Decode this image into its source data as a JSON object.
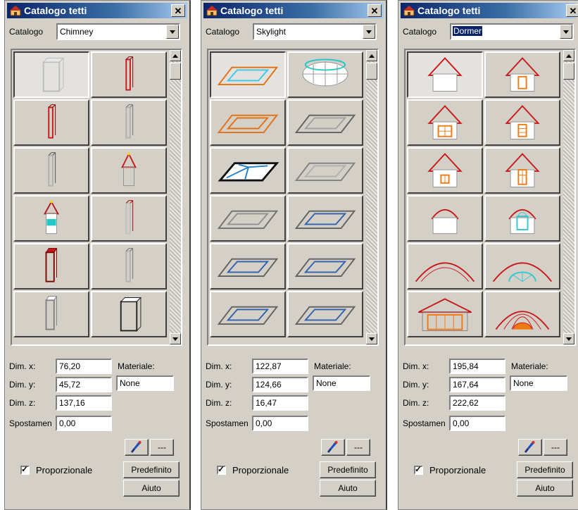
{
  "panels": [
    {
      "title": "Catalogo tetti",
      "catalog_label": "Catalogo",
      "catalog_value": "Chimney",
      "catalog_focused": false,
      "thumbnail_kind": "chimney",
      "fields": [
        {
          "label": "Dim. x:",
          "value": "76,20"
        },
        {
          "label": "Dim. y:",
          "value": "45,72"
        },
        {
          "label": "Dim. z:",
          "value": "137,16"
        },
        {
          "label": "Spostamen",
          "value": "0,00"
        }
      ],
      "material_label": "Materiale:",
      "material_value": "None",
      "dash_button": "---",
      "proportional_label": "Proporzionale",
      "proportional_checked": true,
      "default_button": "Predefinito",
      "help_button": "Aiuto"
    },
    {
      "title": "Catalogo tetti",
      "catalog_label": "Catalogo",
      "catalog_value": "Skylight",
      "catalog_focused": false,
      "thumbnail_kind": "skylight",
      "fields": [
        {
          "label": "Dim. x:",
          "value": "122,87"
        },
        {
          "label": "Dim. y:",
          "value": "124,66"
        },
        {
          "label": "Dim. z:",
          "value": "16,47"
        },
        {
          "label": "Spostamen",
          "value": "0,00"
        }
      ],
      "material_label": "Materiale:",
      "material_value": "None",
      "dash_button": "---",
      "proportional_label": "Proporzionale",
      "proportional_checked": true,
      "default_button": "Predefinito",
      "help_button": "Aiuto"
    },
    {
      "title": "Catalogo tetti",
      "catalog_label": "Catalogo",
      "catalog_value": "Dormer",
      "catalog_focused": true,
      "thumbnail_kind": "dormer",
      "fields": [
        {
          "label": "Dim. x:",
          "value": "195,84"
        },
        {
          "label": "Dim. y:",
          "value": "167,64"
        },
        {
          "label": "Dim. z:",
          "value": "222,62"
        },
        {
          "label": "Spostamen",
          "value": "0,00"
        }
      ],
      "material_label": "Materiale:",
      "material_value": "None",
      "dash_button": "---",
      "proportional_label": "Proporzionale",
      "proportional_checked": true,
      "default_button": "Predefinito",
      "help_button": "Aiuto"
    }
  ],
  "colors": {
    "title_start": "#0a246a",
    "title_end": "#a6caf0",
    "face": "#d4d0c8"
  }
}
